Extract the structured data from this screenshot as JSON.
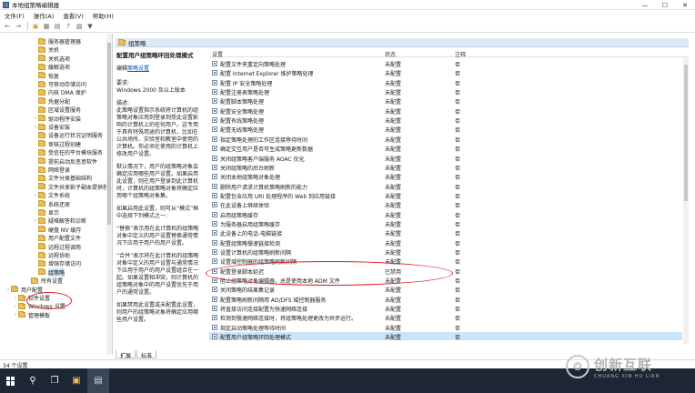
{
  "window": {
    "title": "本地组策略编辑器",
    "minimize": "—",
    "maximize": "☐",
    "close": "✕"
  },
  "menu": [
    "文件(F)",
    "操作(A)",
    "查看(V)",
    "帮助(H)"
  ],
  "toolbar_icons": [
    "back-arrow-icon",
    "forward-arrow-icon",
    "folder-up-icon",
    "show-hide-tree-icon",
    "export-list-icon",
    "help-icon",
    "properties-icon",
    "filter-icon"
  ],
  "tree": {
    "items": [
      {
        "label": "服务器管理器",
        "depth": 3,
        "exp": ""
      },
      {
        "label": "关机",
        "depth": 3,
        "exp": ""
      },
      {
        "label": "关机选项",
        "depth": 3,
        "exp": ""
      },
      {
        "label": "缓解选项",
        "depth": 3,
        "exp": ""
      },
      {
        "label": "恢复",
        "depth": 3,
        "exp": ""
      },
      {
        "label": "可移动存储访问",
        "depth": 3,
        "exp": ""
      },
      {
        "label": "内核 DMA 保护",
        "depth": 3,
        "exp": ""
      },
      {
        "label": "凭据分配",
        "depth": 3,
        "exp": ""
      },
      {
        "label": "区域设置服务",
        "depth": 3,
        "exp": ""
      },
      {
        "label": "驱动程序安装",
        "depth": 3,
        "exp": ">"
      },
      {
        "label": "设备安装",
        "depth": 3,
        "exp": ">"
      },
      {
        "label": "设备运行状况证明服务",
        "depth": 3,
        "exp": ""
      },
      {
        "label": "审核过程创建",
        "depth": 3,
        "exp": ""
      },
      {
        "label": "受信任的平台模块服务",
        "depth": 3,
        "exp": ""
      },
      {
        "label": "提前启动反恶意软件",
        "depth": 3,
        "exp": ""
      },
      {
        "label": "网络登录",
        "depth": 3,
        "exp": ""
      },
      {
        "label": "文件分类基础结构",
        "depth": 3,
        "exp": ""
      },
      {
        "label": "文件共享影子副本提供程序",
        "depth": 3,
        "exp": ""
      },
      {
        "label": "文件系统",
        "depth": 3,
        "exp": ">"
      },
      {
        "label": "系统还原",
        "depth": 3,
        "exp": ""
      },
      {
        "label": "显示",
        "depth": 3,
        "exp": ""
      },
      {
        "label": "疑难解答和诊断",
        "depth": 3,
        "exp": ">"
      },
      {
        "label": "硬盘 NV 缓存",
        "depth": 3,
        "exp": ""
      },
      {
        "label": "用户配置文件",
        "depth": 3,
        "exp": ""
      },
      {
        "label": "远程过程调用",
        "depth": 3,
        "exp": ""
      },
      {
        "label": "远程协助",
        "depth": 3,
        "exp": ""
      },
      {
        "label": "增强存储访问",
        "depth": 3,
        "exp": ""
      },
      {
        "label": "组策略",
        "depth": 3,
        "exp": "",
        "selected": true
      },
      {
        "label": "所有设置",
        "depth": 2,
        "exp": ""
      },
      {
        "label": "用户配置",
        "depth": 0,
        "exp": "v",
        "icon": "user-config-icon"
      },
      {
        "label": "软件设置",
        "depth": 1,
        "exp": ">"
      },
      {
        "label": "Windows 设置",
        "depth": 1,
        "exp": ">"
      },
      {
        "label": "管理模板",
        "depth": 1,
        "exp": ">"
      }
    ]
  },
  "section": {
    "title": "组策略"
  },
  "description": {
    "title": "配置用户组策略环回处理模式",
    "edit_prefix": "编辑",
    "edit_link": "策略设置",
    "requirements_label": "要求:",
    "requirements": "Windows 2000 及以上版本",
    "desc_label": "描述:",
    "desc1": "此策略设置指示系统将计算机的组策略对象应用到登录到受此设置影响的计算机上的任何用户。这专用于具有特殊用途的计算机，比如在公共场所、实验室和教室中使用的计算机。你必须在使用的计算机上修改用户设置。",
    "desc2": "默认情况下，用户的组策略对象会确定应用哪些用户设置。如果启用此设置，则在用户登录到此计算机时，计算机的组策略对象将确定应用哪个组策略对象集。",
    "desc3": "如果启用此设置，则可从“模式”框中选择下列模式之一:",
    "desc4": "“替换”表示用在此计算机的组策略对象中定义的用户设置替换通常情况下应用于用户的用户设置。",
    "desc5": "“合并”表示将在此计算机的组策略对象中定义的用户设置与通常情况下应用于用户的用户设置组合在一起。如果设置相冲突，则计算机的组策略对象中的用户设置优先于用户的通常设置。",
    "desc6": "如果禁用此设置或未配置此设置，则用户的组策略对象将确定应用哪些用户设置。"
  },
  "list": {
    "col_setting": "设置",
    "col_state": "状态",
    "col_comment": "注释",
    "rows": [
      {
        "name": "配置文件夹重定向策略处理",
        "state": "未配置",
        "comment": "否"
      },
      {
        "name": "配置 Internet Explorer 维护策略处理",
        "state": "未配置",
        "comment": "否"
      },
      {
        "name": "配置 IP 安全策略处理",
        "state": "未配置",
        "comment": "否"
      },
      {
        "name": "配置注册表策略处理",
        "state": "未配置",
        "comment": "否"
      },
      {
        "name": "配置脚本策略处理",
        "state": "未配置",
        "comment": "否"
      },
      {
        "name": "配置安全策略处理",
        "state": "未配置",
        "comment": "否"
      },
      {
        "name": "配置有线策略处理",
        "state": "未配置",
        "comment": "否"
      },
      {
        "name": "配置无线策略处理",
        "state": "未配置",
        "comment": "否"
      },
      {
        "name": "指定策略处理的工作区连接等待时间",
        "state": "未配置",
        "comment": "否"
      },
      {
        "name": "确定交互用户是否可生成策略更新数据",
        "state": "未配置",
        "comment": "否"
      },
      {
        "name": "关闭组策略客户端服务 AOAC 优化",
        "state": "未配置",
        "comment": "否"
      },
      {
        "name": "关闭组策略的后台刷新",
        "state": "未配置",
        "comment": "否"
      },
      {
        "name": "关闭本地组策略对象处理",
        "state": "未配置",
        "comment": "否"
      },
      {
        "name": "删除用户请求计算机策略刷新的能力",
        "state": "未配置",
        "comment": "否"
      },
      {
        "name": "配置包含应用 URI 处理程序的 Web 到应用链接",
        "state": "未配置",
        "comment": "否"
      },
      {
        "name": "在此设备上继续体验",
        "state": "未配置",
        "comment": "否"
      },
      {
        "name": "启用组策略缓存",
        "state": "未配置",
        "comment": "否"
      },
      {
        "name": "为服务器启用组策略缓存",
        "state": "未配置",
        "comment": "否"
      },
      {
        "name": "此设备上的电话-电脑链接",
        "state": "未配置",
        "comment": "否"
      },
      {
        "name": "配置组策略慢速链接检测",
        "state": "未配置",
        "comment": "否"
      },
      {
        "name": "设置计算机的组策略刷新间隔",
        "state": "未配置",
        "comment": "否"
      },
      {
        "name": "设置域控制器的组策略刷新间隔",
        "state": "未配置",
        "comment": "否"
      },
      {
        "name": "配置登录脚本延迟",
        "state": "已禁用",
        "comment": "否"
      },
      {
        "name": "阻止组策略对象编辑器，总是使用本地 ADM 文件",
        "state": "未配置",
        "comment": "否"
      },
      {
        "name": "关闭策略的结果集记录",
        "state": "未配置",
        "comment": "否"
      },
      {
        "name": "配置策略刷新间隔用 AD/DFS 域控制器服务",
        "state": "未配置",
        "comment": "否"
      },
      {
        "name": "将直接访问连接配置为快速网络连接",
        "state": "未配置",
        "comment": "否"
      },
      {
        "name": "检测到慢速网络连接时，将组策略处理更改为异步运行。",
        "state": "未配置",
        "comment": "否"
      },
      {
        "name": "指定启动策略处理等待时间",
        "state": "未配置",
        "comment": "否"
      },
      {
        "name": "配置用户组策略环回处理模式",
        "state": "未配置",
        "comment": "否",
        "selected": true
      }
    ]
  },
  "tabs": [
    "扩展",
    "标准"
  ],
  "status": "34 个设置",
  "taskbar_icons": [
    "windows-start-icon",
    "search-icon",
    "task-view-icon",
    "file-explorer-icon",
    "policy-editor-icon"
  ],
  "watermark": {
    "brand": "创新互联",
    "sub": "CHUANG XIN HU LIAN"
  },
  "colors": {
    "selection": "#cce4f7",
    "annotation": "#d22222",
    "taskbar": "#1c2635",
    "link": "#0b57c4"
  }
}
